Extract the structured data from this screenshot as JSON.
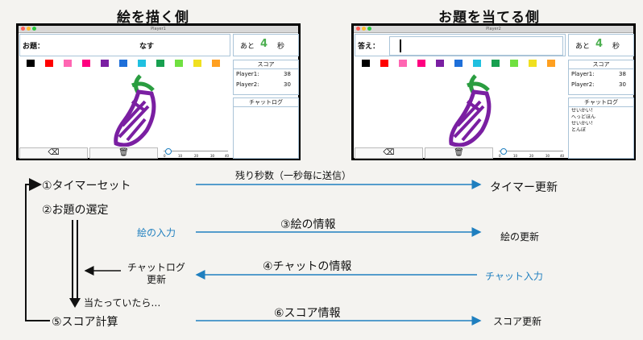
{
  "titles": {
    "drawer": "絵を描く側",
    "guesser": "お題を当てる側"
  },
  "left_window": {
    "title": "Player1",
    "topic_label": "お題：",
    "topic_value": "なす",
    "timer": {
      "prefix": "あと",
      "seconds": "4",
      "suffix": "秒"
    },
    "score_header": "スコア",
    "scores": [
      {
        "player": "Player1:",
        "score": "38"
      },
      {
        "player": "Player2:",
        "score": "30"
      }
    ],
    "chatlog_header": "チャットログ",
    "chat": [],
    "slider_ticks": [
      "0",
      "10",
      "20",
      "30",
      "40"
    ]
  },
  "right_window": {
    "title": "Player2",
    "answer_label": "答え：",
    "timer": {
      "prefix": "あと",
      "seconds": "4",
      "suffix": "秒"
    },
    "score_header": "スコア",
    "scores": [
      {
        "player": "Player1:",
        "score": "38"
      },
      {
        "player": "Player2:",
        "score": "30"
      }
    ],
    "chatlog_header": "チャットログ",
    "chat": [
      "せいかい！",
      "へっどほん",
      "せいかい！",
      "とんぼ"
    ],
    "slider_ticks": [
      "0",
      "10",
      "20",
      "30",
      "40"
    ]
  },
  "palette": [
    "#000000",
    "#ff0000",
    "#ff66b2",
    "#ff0080",
    "#7a1fa2",
    "#1e6fd9",
    "#20c0e0",
    "#18a050",
    "#70e040",
    "#f0e020",
    "#ffa020"
  ],
  "flow": {
    "steps": {
      "s1": "①タイマーセット",
      "s2": "②お題の選定",
      "s5": "⑤スコア計算",
      "correct": "当たっていたら…"
    },
    "left_texts": {
      "drawing_input": "絵の入力",
      "chatlog_update": "チャットログ\n更新"
    },
    "arrow_labels": {
      "a1": "残り秒数（一秒毎に送信）",
      "a3": "③絵の情報",
      "a4": "④チャットの情報",
      "a6": "⑥スコア情報"
    },
    "right_texts": {
      "r1": "タイマー更新",
      "r3": "絵の更新",
      "r4": "チャット入力",
      "r6": "スコア更新"
    }
  },
  "colors": {
    "accent_blue": "#1f7fbf",
    "timer_green": "#4caf50",
    "eggplant": "#7a1fa2",
    "stem": "#2a9d40"
  }
}
